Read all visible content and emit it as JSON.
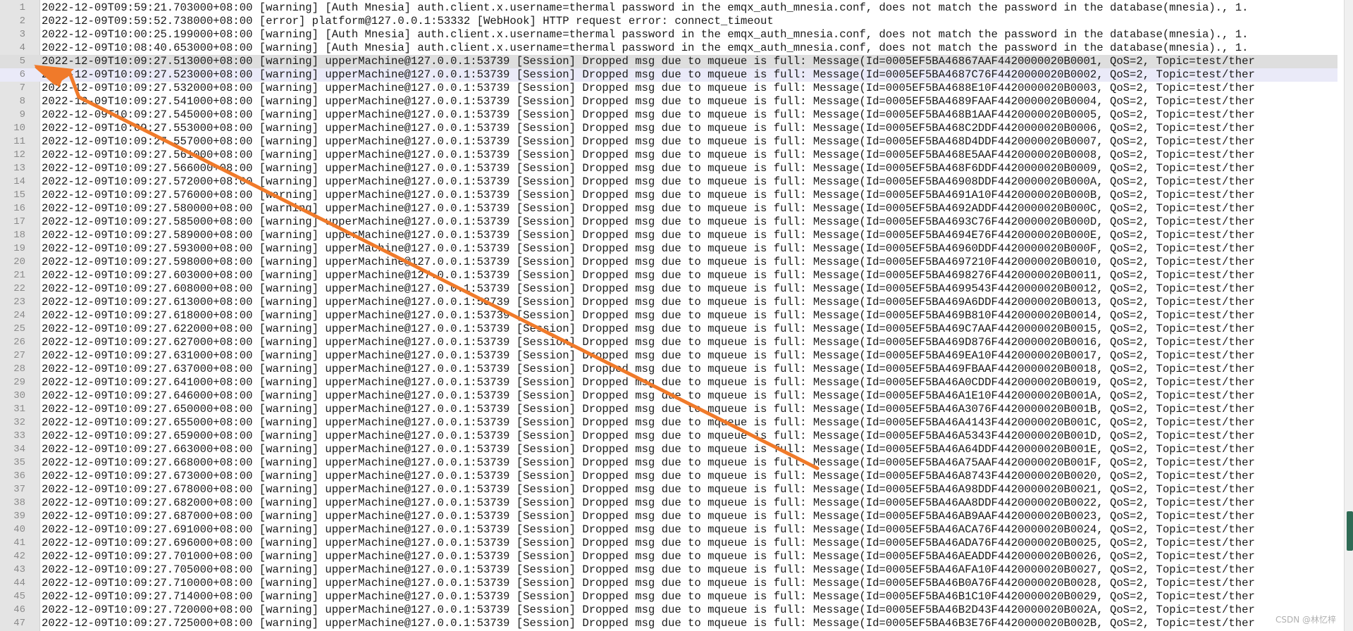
{
  "editor": {
    "current_line": 5,
    "selected_line": 6,
    "lines": [
      {
        "n": "1",
        "text": "2022-12-09T09:59:21.703000+08:00 [warning] [Auth Mnesia] auth.client.x.username=thermal password in the emqx_auth_mnesia.conf, does not match the password in the database(mnesia)., 1."
      },
      {
        "n": "2",
        "text": "2022-12-09T09:59:52.738000+08:00 [error] platform@127.0.0.1:53332 [WebHook] HTTP request error: connect_timeout"
      },
      {
        "n": "3",
        "text": "2022-12-09T10:00:25.199000+08:00 [warning] [Auth Mnesia] auth.client.x.username=thermal password in the emqx_auth_mnesia.conf, does not match the password in the database(mnesia)., 1."
      },
      {
        "n": "4",
        "text": "2022-12-09T10:08:40.653000+08:00 [warning] [Auth Mnesia] auth.client.x.username=thermal password in the emqx_auth_mnesia.conf, does not match the password in the database(mnesia)., 1."
      },
      {
        "n": "5",
        "text": "2022-12-09T10:09:27.513000+08:00 [warning] upperMachine@127.0.0.1:53739 [Session] Dropped msg due to mqueue is full: Message(Id=0005EF5BA46867AAF4420000020B0001, QoS=2, Topic=test/ther"
      },
      {
        "n": "6",
        "text": "2022-12-09T10:09:27.523000+08:00 [warning] upperMachine@127.0.0.1:53739 [Session] Dropped msg due to mqueue is full: Message(Id=0005EF5BA4687C76F4420000020B0002, QoS=2, Topic=test/ther"
      },
      {
        "n": "7",
        "text": "2022-12-09T10:09:27.532000+08:00 [warning] upperMachine@127.0.0.1:53739 [Session] Dropped msg due to mqueue is full: Message(Id=0005EF5BA4688E10F4420000020B0003, QoS=2, Topic=test/ther"
      },
      {
        "n": "8",
        "text": "2022-12-09T10:09:27.541000+08:00 [warning] upperMachine@127.0.0.1:53739 [Session] Dropped msg due to mqueue is full: Message(Id=0005EF5BA4689FAAF4420000020B0004, QoS=2, Topic=test/ther"
      },
      {
        "n": "9",
        "text": "2022-12-09T10:09:27.545000+08:00 [warning] upperMachine@127.0.0.1:53739 [Session] Dropped msg due to mqueue is full: Message(Id=0005EF5BA468B1AAF4420000020B0005, QoS=2, Topic=test/ther"
      },
      {
        "n": "10",
        "text": "2022-12-09T10:09:27.553000+08:00 [warning] upperMachine@127.0.0.1:53739 [Session] Dropped msg due to mqueue is full: Message(Id=0005EF5BA468C2DDF4420000020B0006, QoS=2, Topic=test/ther"
      },
      {
        "n": "11",
        "text": "2022-12-09T10:09:27.557000+08:00 [warning] upperMachine@127.0.0.1:53739 [Session] Dropped msg due to mqueue is full: Message(Id=0005EF5BA468D4DDF4420000020B0007, QoS=2, Topic=test/ther"
      },
      {
        "n": "12",
        "text": "2022-12-09T10:09:27.561000+08:00 [warning] upperMachine@127.0.0.1:53739 [Session] Dropped msg due to mqueue is full: Message(Id=0005EF5BA468E5AAF4420000020B0008, QoS=2, Topic=test/ther"
      },
      {
        "n": "13",
        "text": "2022-12-09T10:09:27.566000+08:00 [warning] upperMachine@127.0.0.1:53739 [Session] Dropped msg due to mqueue is full: Message(Id=0005EF5BA468F6DDF4420000020B0009, QoS=2, Topic=test/ther"
      },
      {
        "n": "14",
        "text": "2022-12-09T10:09:27.572000+08:00 [warning] upperMachine@127.0.0.1:53739 [Session] Dropped msg due to mqueue is full: Message(Id=0005EF5BA46908DDF4420000020B000A, QoS=2, Topic=test/ther"
      },
      {
        "n": "15",
        "text": "2022-12-09T10:09:27.576000+08:00 [warning] upperMachine@127.0.0.1:53739 [Session] Dropped msg due to mqueue is full: Message(Id=0005EF5BA4691A10F4420000020B000B, QoS=2, Topic=test/ther"
      },
      {
        "n": "16",
        "text": "2022-12-09T10:09:27.580000+08:00 [warning] upperMachine@127.0.0.1:53739 [Session] Dropped msg due to mqueue is full: Message(Id=0005EF5BA4692ADDF4420000020B000C, QoS=2, Topic=test/ther"
      },
      {
        "n": "17",
        "text": "2022-12-09T10:09:27.585000+08:00 [warning] upperMachine@127.0.0.1:53739 [Session] Dropped msg due to mqueue is full: Message(Id=0005EF5BA4693C76F4420000020B000D, QoS=2, Topic=test/ther"
      },
      {
        "n": "18",
        "text": "2022-12-09T10:09:27.589000+08:00 [warning] upperMachine@127.0.0.1:53739 [Session] Dropped msg due to mqueue is full: Message(Id=0005EF5BA4694E76F4420000020B000E, QoS=2, Topic=test/ther"
      },
      {
        "n": "19",
        "text": "2022-12-09T10:09:27.593000+08:00 [warning] upperMachine@127.0.0.1:53739 [Session] Dropped msg due to mqueue is full: Message(Id=0005EF5BA46960DDF4420000020B000F, QoS=2, Topic=test/ther"
      },
      {
        "n": "20",
        "text": "2022-12-09T10:09:27.598000+08:00 [warning] upperMachine@127.0.0.1:53739 [Session] Dropped msg due to mqueue is full: Message(Id=0005EF5BA4697210F4420000020B0010, QoS=2, Topic=test/ther"
      },
      {
        "n": "21",
        "text": "2022-12-09T10:09:27.603000+08:00 [warning] upperMachine@127.0.0.1:53739 [Session] Dropped msg due to mqueue is full: Message(Id=0005EF5BA4698276F4420000020B0011, QoS=2, Topic=test/ther"
      },
      {
        "n": "22",
        "text": "2022-12-09T10:09:27.608000+08:00 [warning] upperMachine@127.0.0.1:53739 [Session] Dropped msg due to mqueue is full: Message(Id=0005EF5BA4699543F4420000020B0012, QoS=2, Topic=test/ther"
      },
      {
        "n": "23",
        "text": "2022-12-09T10:09:27.613000+08:00 [warning] upperMachine@127.0.0.1:53739 [Session] Dropped msg due to mqueue is full: Message(Id=0005EF5BA469A6DDF4420000020B0013, QoS=2, Topic=test/ther"
      },
      {
        "n": "24",
        "text": "2022-12-09T10:09:27.618000+08:00 [warning] upperMachine@127.0.0.1:53739 [Session] Dropped msg due to mqueue is full: Message(Id=0005EF5BA469B810F4420000020B0014, QoS=2, Topic=test/ther"
      },
      {
        "n": "25",
        "text": "2022-12-09T10:09:27.622000+08:00 [warning] upperMachine@127.0.0.1:53739 [Session] Dropped msg due to mqueue is full: Message(Id=0005EF5BA469C7AAF4420000020B0015, QoS=2, Topic=test/ther"
      },
      {
        "n": "26",
        "text": "2022-12-09T10:09:27.627000+08:00 [warning] upperMachine@127.0.0.1:53739 [Session] Dropped msg due to mqueue is full: Message(Id=0005EF5BA469D876F4420000020B0016, QoS=2, Topic=test/ther"
      },
      {
        "n": "27",
        "text": "2022-12-09T10:09:27.631000+08:00 [warning] upperMachine@127.0.0.1:53739 [Session] Dropped msg due to mqueue is full: Message(Id=0005EF5BA469EA10F4420000020B0017, QoS=2, Topic=test/ther"
      },
      {
        "n": "28",
        "text": "2022-12-09T10:09:27.637000+08:00 [warning] upperMachine@127.0.0.1:53739 [Session] Dropped msg due to mqueue is full: Message(Id=0005EF5BA469FBAAF4420000020B0018, QoS=2, Topic=test/ther"
      },
      {
        "n": "29",
        "text": "2022-12-09T10:09:27.641000+08:00 [warning] upperMachine@127.0.0.1:53739 [Session] Dropped msg due to mqueue is full: Message(Id=0005EF5BA46A0CDDF4420000020B0019, QoS=2, Topic=test/ther"
      },
      {
        "n": "30",
        "text": "2022-12-09T10:09:27.646000+08:00 [warning] upperMachine@127.0.0.1:53739 [Session] Dropped msg due to mqueue is full: Message(Id=0005EF5BA46A1E10F4420000020B001A, QoS=2, Topic=test/ther"
      },
      {
        "n": "31",
        "text": "2022-12-09T10:09:27.650000+08:00 [warning] upperMachine@127.0.0.1:53739 [Session] Dropped msg due to mqueue is full: Message(Id=0005EF5BA46A3076F4420000020B001B, QoS=2, Topic=test/ther"
      },
      {
        "n": "32",
        "text": "2022-12-09T10:09:27.655000+08:00 [warning] upperMachine@127.0.0.1:53739 [Session] Dropped msg due to mqueue is full: Message(Id=0005EF5BA46A4143F4420000020B001C, QoS=2, Topic=test/ther"
      },
      {
        "n": "33",
        "text": "2022-12-09T10:09:27.659000+08:00 [warning] upperMachine@127.0.0.1:53739 [Session] Dropped msg due to mqueue is full: Message(Id=0005EF5BA46A5343F4420000020B001D, QoS=2, Topic=test/ther"
      },
      {
        "n": "34",
        "text": "2022-12-09T10:09:27.663000+08:00 [warning] upperMachine@127.0.0.1:53739 [Session] Dropped msg due to mqueue is full: Message(Id=0005EF5BA46A64DDF4420000020B001E, QoS=2, Topic=test/ther"
      },
      {
        "n": "35",
        "text": "2022-12-09T10:09:27.668000+08:00 [warning] upperMachine@127.0.0.1:53739 [Session] Dropped msg due to mqueue is full: Message(Id=0005EF5BA46A75AAF4420000020B001F, QoS=2, Topic=test/ther"
      },
      {
        "n": "36",
        "text": "2022-12-09T10:09:27.673000+08:00 [warning] upperMachine@127.0.0.1:53739 [Session] Dropped msg due to mqueue is full: Message(Id=0005EF5BA46A8743F4420000020B0020, QoS=2, Topic=test/ther"
      },
      {
        "n": "37",
        "text": "2022-12-09T10:09:27.678000+08:00 [warning] upperMachine@127.0.0.1:53739 [Session] Dropped msg due to mqueue is full: Message(Id=0005EF5BA46A98DDF4420000020B0021, QoS=2, Topic=test/ther"
      },
      {
        "n": "38",
        "text": "2022-12-09T10:09:27.682000+08:00 [warning] upperMachine@127.0.0.1:53739 [Session] Dropped msg due to mqueue is full: Message(Id=0005EF5BA46AA8DDF4420000020B0022, QoS=2, Topic=test/ther"
      },
      {
        "n": "39",
        "text": "2022-12-09T10:09:27.687000+08:00 [warning] upperMachine@127.0.0.1:53739 [Session] Dropped msg due to mqueue is full: Message(Id=0005EF5BA46AB9AAF4420000020B0023, QoS=2, Topic=test/ther"
      },
      {
        "n": "40",
        "text": "2022-12-09T10:09:27.691000+08:00 [warning] upperMachine@127.0.0.1:53739 [Session] Dropped msg due to mqueue is full: Message(Id=0005EF5BA46ACA76F4420000020B0024, QoS=2, Topic=test/ther"
      },
      {
        "n": "41",
        "text": "2022-12-09T10:09:27.696000+08:00 [warning] upperMachine@127.0.0.1:53739 [Session] Dropped msg due to mqueue is full: Message(Id=0005EF5BA46ADA76F4420000020B0025, QoS=2, Topic=test/ther"
      },
      {
        "n": "42",
        "text": "2022-12-09T10:09:27.701000+08:00 [warning] upperMachine@127.0.0.1:53739 [Session] Dropped msg due to mqueue is full: Message(Id=0005EF5BA46AEADDF4420000020B0026, QoS=2, Topic=test/ther"
      },
      {
        "n": "43",
        "text": "2022-12-09T10:09:27.705000+08:00 [warning] upperMachine@127.0.0.1:53739 [Session] Dropped msg due to mqueue is full: Message(Id=0005EF5BA46AFA10F4420000020B0027, QoS=2, Topic=test/ther"
      },
      {
        "n": "44",
        "text": "2022-12-09T10:09:27.710000+08:00 [warning] upperMachine@127.0.0.1:53739 [Session] Dropped msg due to mqueue is full: Message(Id=0005EF5BA46B0A76F4420000020B0028, QoS=2, Topic=test/ther"
      },
      {
        "n": "45",
        "text": "2022-12-09T10:09:27.714000+08:00 [warning] upperMachine@127.0.0.1:53739 [Session] Dropped msg due to mqueue is full: Message(Id=0005EF5BA46B1C10F4420000020B0029, QoS=2, Topic=test/ther"
      },
      {
        "n": "46",
        "text": "2022-12-09T10:09:27.720000+08:00 [warning] upperMachine@127.0.0.1:53739 [Session] Dropped msg due to mqueue is full: Message(Id=0005EF5BA46B2D43F4420000020B002A, QoS=2, Topic=test/ther"
      },
      {
        "n": "47",
        "text": "2022-12-09T10:09:27.725000+08:00 [warning] upperMachine@127.0.0.1:53739 [Session] Dropped msg due to mqueue is full: Message(Id=0005EF5BA46B3E76F4420000020B002B, QoS=2, Topic=test/ther"
      }
    ]
  },
  "annotation": {
    "color": "#f07a2a"
  },
  "watermark": "CSDN @林忆梓"
}
